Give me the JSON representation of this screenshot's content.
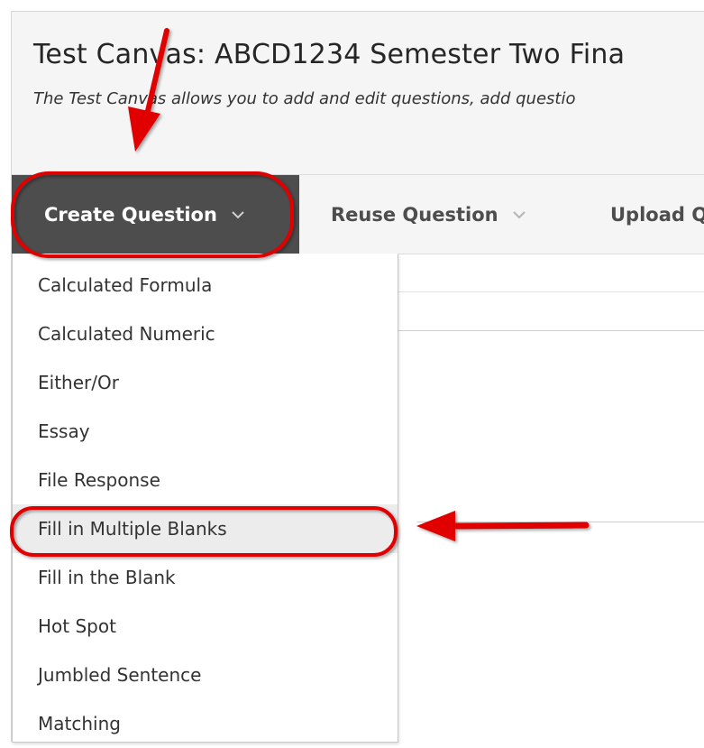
{
  "header": {
    "title": "Test Canvas: ABCD1234 Semester Two Fina",
    "subtitle": "The Test Canvas allows you to add and edit questions, add questio"
  },
  "toolbar": {
    "create_label": "Create Question",
    "reuse_label": "Reuse Question",
    "upload_label": "Upload Q"
  },
  "menu": {
    "items": [
      {
        "label": "Calculated Formula"
      },
      {
        "label": "Calculated Numeric"
      },
      {
        "label": "Either/Or"
      },
      {
        "label": "Essay"
      },
      {
        "label": "File Response"
      },
      {
        "label": "Fill in Multiple Blanks"
      },
      {
        "label": "Fill in the Blank"
      },
      {
        "label": "Hot Spot"
      },
      {
        "label": "Jumbled Sentence"
      },
      {
        "label": "Matching"
      }
    ],
    "highlighted_index": 5
  },
  "annotations": {
    "color": "#e00000"
  }
}
